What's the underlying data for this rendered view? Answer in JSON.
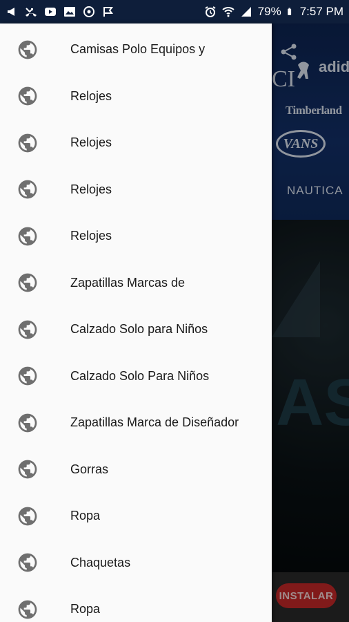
{
  "status_bar": {
    "battery": "79%",
    "time": "7:57 PM"
  },
  "background": {
    "brands": {
      "ci": "CI",
      "adidas": "adid",
      "timberland": "Timberland",
      "vans": "VANS",
      "nautica": "NAUTICA"
    },
    "big_text": "AS",
    "install_label": "INSTALAR"
  },
  "drawer": {
    "items": [
      {
        "label": "Camisas Polo Equipos y",
        "icon": "globe-icon"
      },
      {
        "label": "Relojes",
        "icon": "globe-icon"
      },
      {
        "label": "Relojes",
        "icon": "globe-icon"
      },
      {
        "label": "Relojes",
        "icon": "globe-icon"
      },
      {
        "label": "Relojes",
        "icon": "globe-icon"
      },
      {
        "label": "Zapatillas Marcas de",
        "icon": "globe-icon"
      },
      {
        "label": "Calzado Solo para Niños",
        "icon": "globe-icon"
      },
      {
        "label": "Calzado Solo Para Niños",
        "icon": "globe-icon"
      },
      {
        "label": "Zapatillas Marca de Diseñador",
        "icon": "globe-icon"
      },
      {
        "label": "Gorras",
        "icon": "globe-icon"
      },
      {
        "label": "Ropa",
        "icon": "globe-icon"
      },
      {
        "label": "Chaquetas",
        "icon": "globe-icon"
      },
      {
        "label": "Ropa",
        "icon": "globe-icon"
      }
    ]
  },
  "colors": {
    "status_bar": "#0e1e3a",
    "drawer_bg": "#fafafa",
    "icon": "#6f6f6f",
    "install_button": "#c62828"
  }
}
